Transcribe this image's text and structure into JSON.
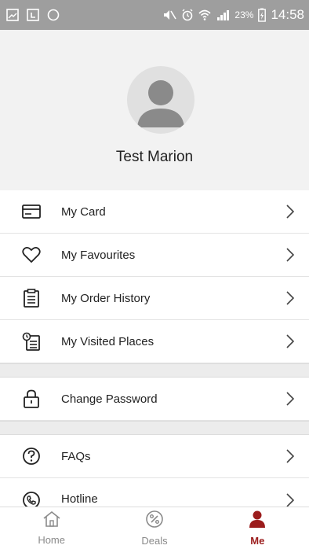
{
  "status_bar": {
    "battery": "23%",
    "time": "14:58"
  },
  "profile": {
    "name": "Test Marion"
  },
  "menu": {
    "items": [
      {
        "label": "My Card",
        "icon": "card-icon"
      },
      {
        "label": "My Favourites",
        "icon": "heart-icon"
      },
      {
        "label": "My Order History",
        "icon": "clipboard-icon"
      },
      {
        "label": "My Visited Places",
        "icon": "visited-list-icon"
      },
      {
        "label": "Change Password",
        "icon": "lock-icon"
      },
      {
        "label": "FAQs",
        "icon": "question-icon"
      },
      {
        "label": "Hotline",
        "icon": "phone-icon"
      }
    ]
  },
  "bottom_nav": {
    "tabs": [
      {
        "label": "Home",
        "icon": "home-icon",
        "active": false
      },
      {
        "label": "Deals",
        "icon": "percent-icon",
        "active": false
      },
      {
        "label": "Me",
        "icon": "person-icon",
        "active": true
      }
    ]
  },
  "colors": {
    "accent": "#9b1c1c",
    "status_bar": "#9e9e9e",
    "background": "#f2f2f2"
  }
}
